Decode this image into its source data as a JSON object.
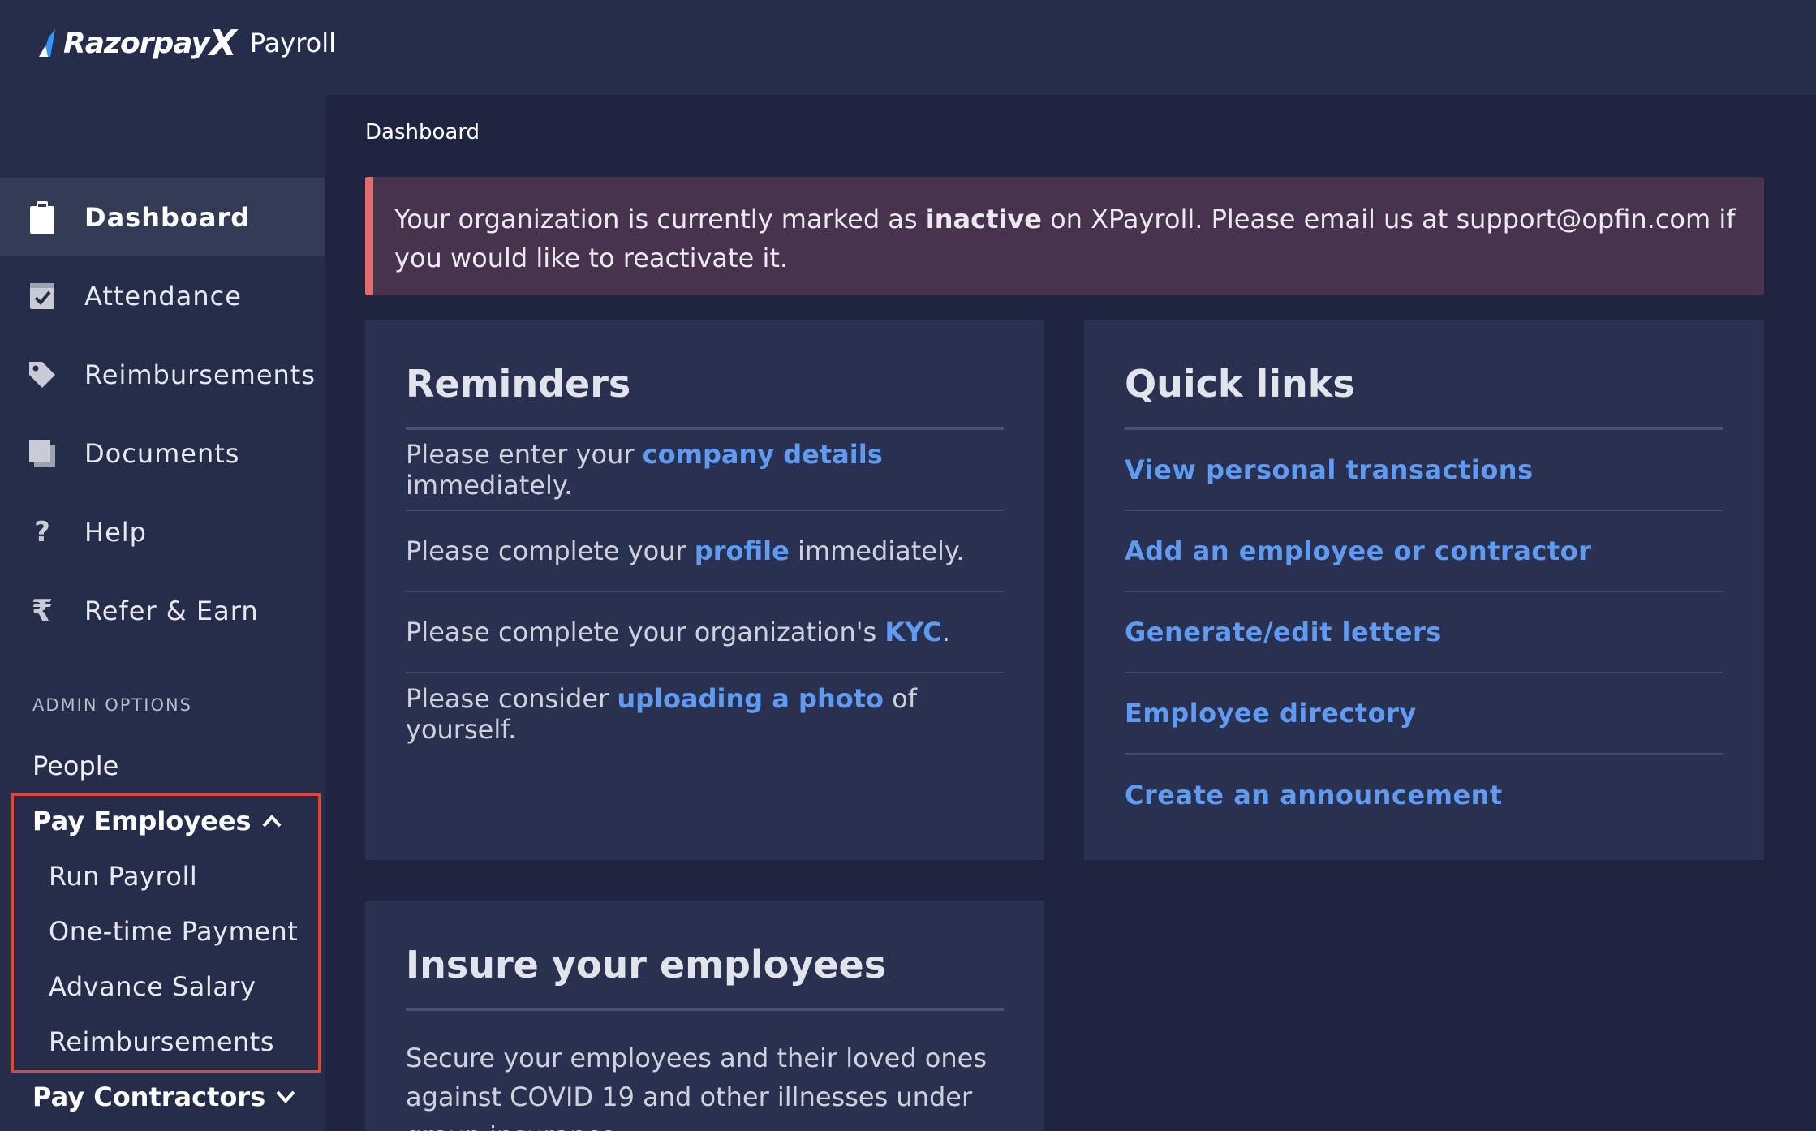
{
  "header": {
    "logo_text": "Razorpay",
    "logo_x": "X",
    "product": "Payroll"
  },
  "sidebar": {
    "items": [
      {
        "label": "Dashboard",
        "icon": "clipboard-icon",
        "active": true
      },
      {
        "label": "Attendance",
        "icon": "calendar-check-icon",
        "active": false
      },
      {
        "label": "Reimbursements",
        "icon": "tag-icon",
        "active": false
      },
      {
        "label": "Documents",
        "icon": "documents-icon",
        "active": false
      },
      {
        "label": "Help",
        "icon": "question-icon",
        "active": false
      },
      {
        "label": "Refer & Earn",
        "icon": "rupee-icon",
        "active": false
      }
    ],
    "admin_heading": "ADMIN OPTIONS",
    "admin": {
      "people": "People",
      "pay_employees": "Pay Employees",
      "pay_employees_sub": [
        "Run Payroll",
        "One-time Payment",
        "Advance Salary",
        "Reimbursements"
      ],
      "pay_contractors": "Pay Contractors"
    }
  },
  "breadcrumb": "Dashboard",
  "alert": {
    "before": "Your organization is currently marked as ",
    "status": "inactive",
    "after": " on XPayroll. Please email us at support@opfin.com if you would like to reactivate it."
  },
  "reminders": {
    "title": "Reminders",
    "items": [
      {
        "before": "Please enter your ",
        "link": "company details",
        "after": " immediately."
      },
      {
        "before": "Please complete your ",
        "link": "profile",
        "after": " immediately."
      },
      {
        "before": "Please complete your organization's ",
        "link": "KYC",
        "after": "."
      },
      {
        "before": "Please consider ",
        "link": "uploading a photo",
        "after": " of yourself."
      }
    ]
  },
  "quick_links": {
    "title": "Quick links",
    "items": [
      "View personal transactions",
      "Add an employee or contractor",
      "Generate/edit letters",
      "Employee directory",
      "Create an announcement"
    ]
  },
  "insure": {
    "title": "Insure your employees",
    "text": "Secure your employees and their loved ones against COVID 19 and other illnesses under group insurance."
  },
  "colors": {
    "background": "#1f2540",
    "panel": "#252d4b",
    "card": "#2a3150",
    "link": "#5f9bf2",
    "alert_bg": "#47334d",
    "alert_border": "#e26b6b",
    "highlight": "#e0473a"
  }
}
